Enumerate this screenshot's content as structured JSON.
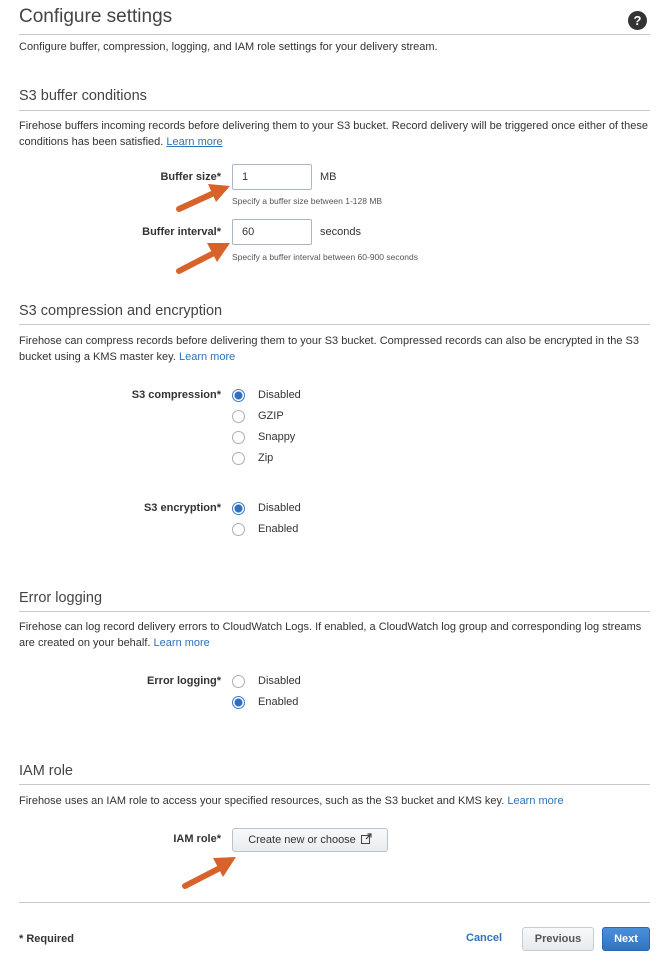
{
  "header": {
    "title": "Configure settings",
    "help_icon": "question-circle-icon",
    "intro": "Configure buffer, compression, logging, and IAM role settings for your delivery stream."
  },
  "buffer": {
    "title": "S3 buffer conditions",
    "description": "Firehose buffers incoming records before delivering them to your S3 bucket. Record delivery will be triggered once either of these conditions has been satisfied.",
    "learn_more": "Learn more",
    "size_label": "Buffer size*",
    "size_value": "1",
    "size_unit": "MB",
    "size_hint": "Specify a buffer size between 1-128 MB",
    "interval_label": "Buffer interval*",
    "interval_value": "60",
    "interval_unit": "seconds",
    "interval_hint": "Specify a buffer interval between 60-900 seconds"
  },
  "compression": {
    "title": "S3 compression and encryption",
    "description": "Firehose can compress records before delivering them to your S3 bucket. Compressed records can also be encrypted in the S3 bucket using a KMS master key.",
    "learn_more": "Learn more",
    "compression_label": "S3 compression*",
    "compression_options": [
      "Disabled",
      "GZIP",
      "Snappy",
      "Zip"
    ],
    "compression_selected": "Disabled",
    "encryption_label": "S3 encryption*",
    "encryption_options": [
      "Disabled",
      "Enabled"
    ],
    "encryption_selected": "Disabled"
  },
  "logging": {
    "title": "Error logging",
    "description": "Firehose can log record delivery errors to CloudWatch Logs. If enabled, a CloudWatch log group and corresponding log streams are created on your behalf.",
    "learn_more": "Learn more",
    "label": "Error logging*",
    "options": [
      "Disabled",
      "Enabled"
    ],
    "selected": "Enabled"
  },
  "iam": {
    "title": "IAM role",
    "description": "Firehose uses an IAM role to access your specified resources, such as the S3 bucket and KMS key.",
    "learn_more": "Learn more",
    "label": "IAM role*",
    "button": "Create new or choose",
    "button_icon": "external-link-icon"
  },
  "footer": {
    "required": "* Required",
    "cancel": "Cancel",
    "previous": "Previous",
    "next": "Next"
  },
  "colors": {
    "link": "#2d73b8",
    "primary_button": "#3a7fcd",
    "annotation_arrow": "#d7632b"
  }
}
